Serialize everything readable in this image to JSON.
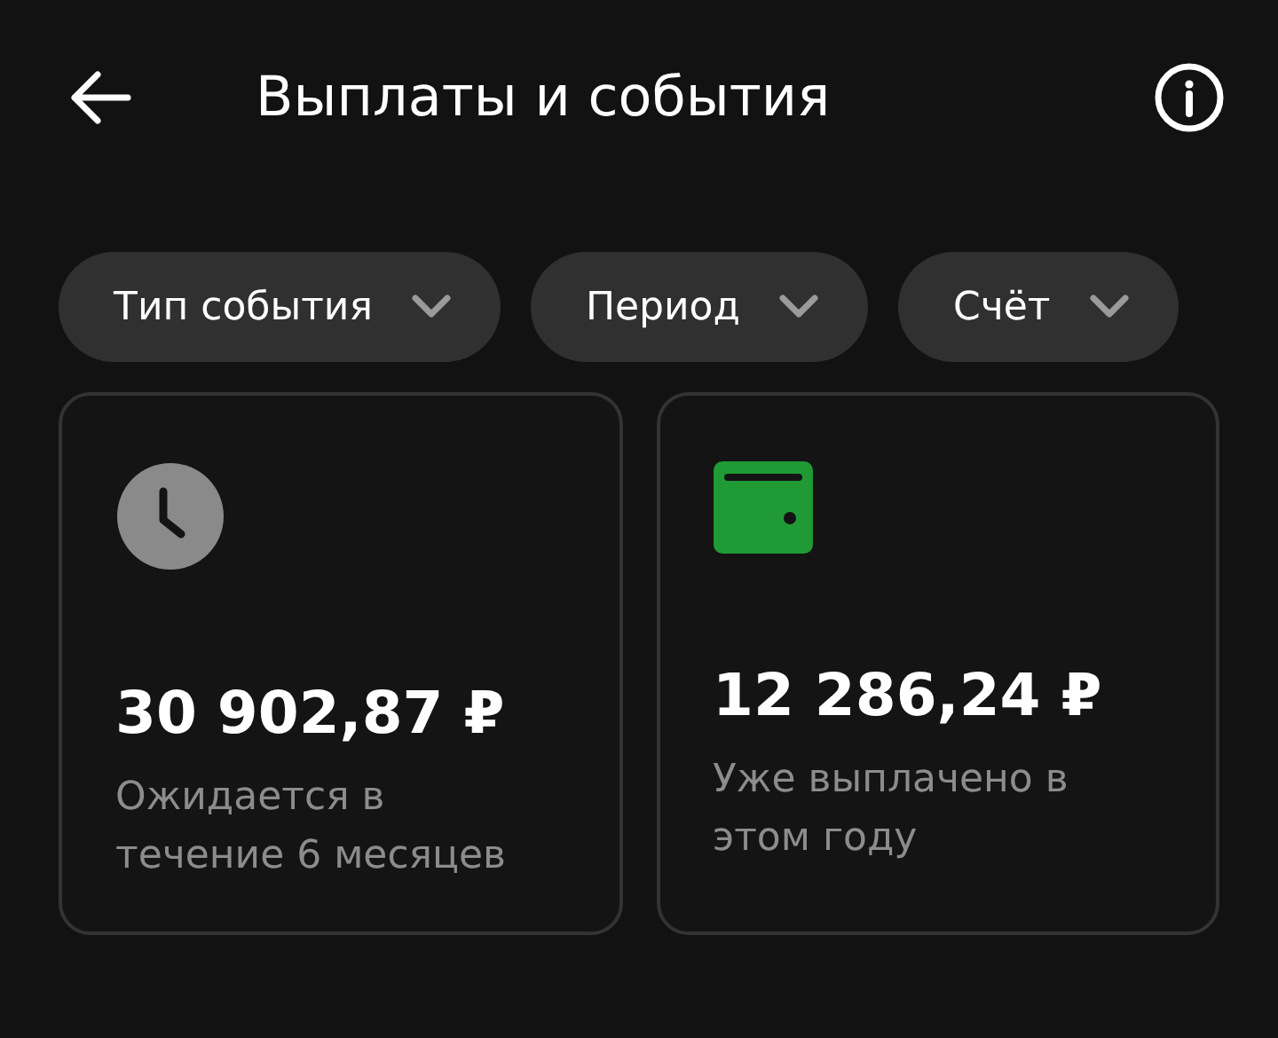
{
  "header": {
    "title": "Выплаты и события"
  },
  "filters": [
    {
      "label": "Тип события"
    },
    {
      "label": "Период"
    },
    {
      "label": "Счёт"
    }
  ],
  "cards": [
    {
      "kind": "clock",
      "amount": "30 902,87 ₽",
      "description": "Ожидается в течение 6 месяцев"
    },
    {
      "kind": "wallet",
      "amount": "12 286,24 ₽",
      "description": "Уже выплачено в этом году"
    }
  ]
}
